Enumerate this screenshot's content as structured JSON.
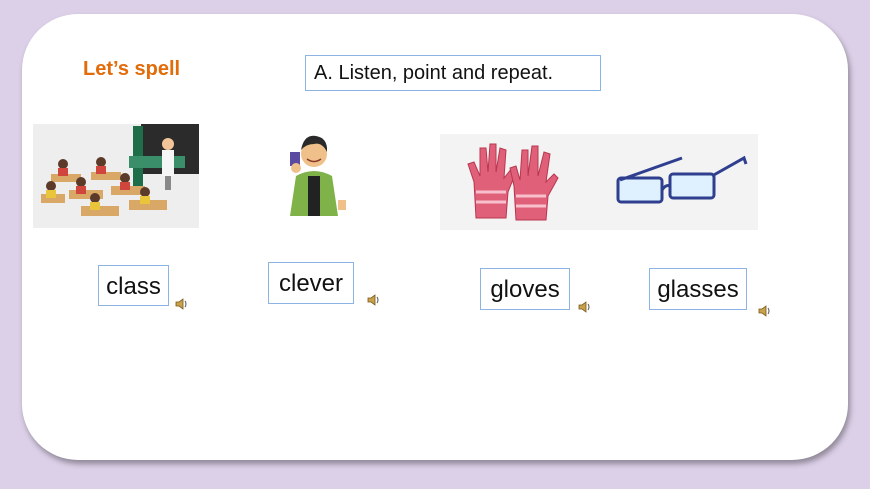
{
  "slide": {
    "title": "Let’s spell",
    "instruction": "A.  Listen, point and repeat."
  },
  "pictures": [
    {
      "name": "classroom-image"
    },
    {
      "name": "boy-image"
    },
    {
      "name": "gloves-image"
    },
    {
      "name": "glasses-image"
    }
  ],
  "words": [
    {
      "label": "class",
      "icon": "speaker-icon"
    },
    {
      "label": "clever",
      "icon": "speaker-icon"
    },
    {
      "label": "gloves",
      "icon": "speaker-icon"
    },
    {
      "label": "glasses",
      "icon": "speaker-icon"
    }
  ],
  "colors": {
    "title": "#e36c0a",
    "box_border": "#8db3e2",
    "background": "#dcd0e8"
  }
}
